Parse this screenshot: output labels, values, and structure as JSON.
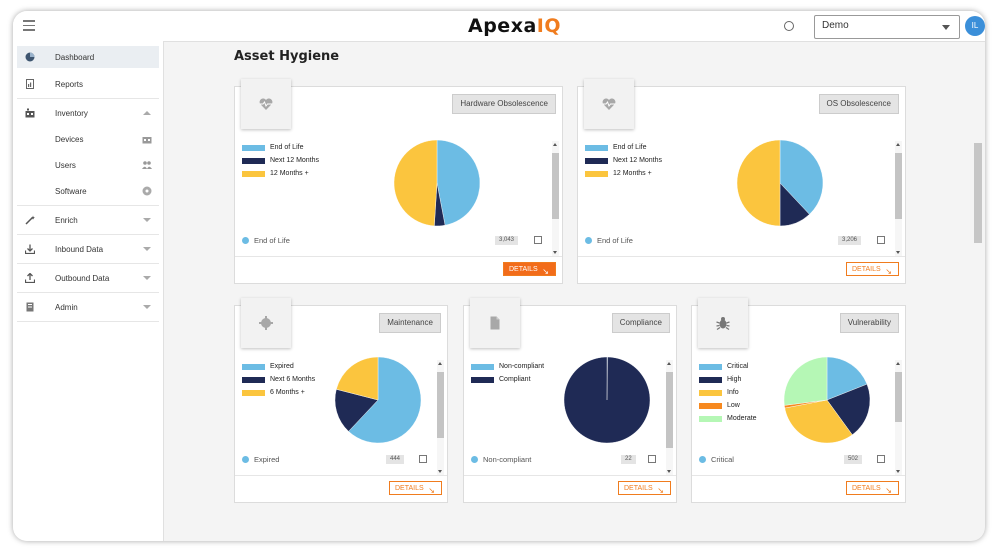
{
  "header": {
    "logo_text": "Apexa",
    "logo_suffix": "IQ",
    "org_select": "Demo",
    "avatar_initials": "IL"
  },
  "sidebar": {
    "items": [
      {
        "label": "Dashboard"
      },
      {
        "label": "Reports"
      },
      {
        "label": "Inventory"
      },
      {
        "label": "Devices"
      },
      {
        "label": "Users"
      },
      {
        "label": "Software"
      },
      {
        "label": "Enrich"
      },
      {
        "label": "Inbound Data"
      },
      {
        "label": "Outbound Data"
      },
      {
        "label": "Admin"
      }
    ]
  },
  "page": {
    "title": "Asset Hygiene"
  },
  "cards": [
    {
      "title": "Hardware Obsolescence",
      "legend": [
        {
          "label": "End of Life",
          "color": "#6cbce4"
        },
        {
          "label": "Next 12 Months",
          "color": "#1f2a55"
        },
        {
          "label": "12 Months +",
          "color": "#fbc53e"
        }
      ],
      "slices": [
        0.47,
        0.04,
        0.49
      ],
      "stat_label": "End of Life",
      "count": "3,043",
      "details": "DETAILS"
    },
    {
      "title": "OS Obsolescence",
      "legend": [
        {
          "label": "End of Life",
          "color": "#6cbce4"
        },
        {
          "label": "Next 12 Months",
          "color": "#1f2a55"
        },
        {
          "label": "12 Months +",
          "color": "#fbc53e"
        }
      ],
      "slices": [
        0.38,
        0.12,
        0.5
      ],
      "stat_label": "End of Life",
      "count": "3,206",
      "details": "DETAILS"
    },
    {
      "title": "Maintenance",
      "legend": [
        {
          "label": "Expired",
          "color": "#6cbce4"
        },
        {
          "label": "Next 6 Months",
          "color": "#1f2a55"
        },
        {
          "label": "6 Months +",
          "color": "#fbc53e"
        }
      ],
      "slices": [
        0.62,
        0.17,
        0.21
      ],
      "stat_label": "Expired",
      "count": "444",
      "details": "DETAILS"
    },
    {
      "title": "Compliance",
      "legend": [
        {
          "label": "Non-compliant",
          "color": "#6cbce4"
        },
        {
          "label": "Compliant",
          "color": "#1f2a55"
        }
      ],
      "slices": [
        0.002,
        0.998
      ],
      "stat_label": "Non-compliant",
      "count": "22",
      "details": "DETAILS"
    },
    {
      "title": "Vulnerability",
      "legend": [
        {
          "label": "Critical",
          "color": "#6cbce4"
        },
        {
          "label": "High",
          "color": "#1f2a55"
        },
        {
          "label": "Info",
          "color": "#fbc53e"
        },
        {
          "label": "Low",
          "color": "#f7891f"
        },
        {
          "label": "Moderate",
          "color": "#b5f7b5"
        }
      ],
      "slices": [
        0.19,
        0.21,
        0.32,
        0.01,
        0.27
      ],
      "stat_label": "Critical",
      "count": "502",
      "details": "DETAILS"
    }
  ]
}
